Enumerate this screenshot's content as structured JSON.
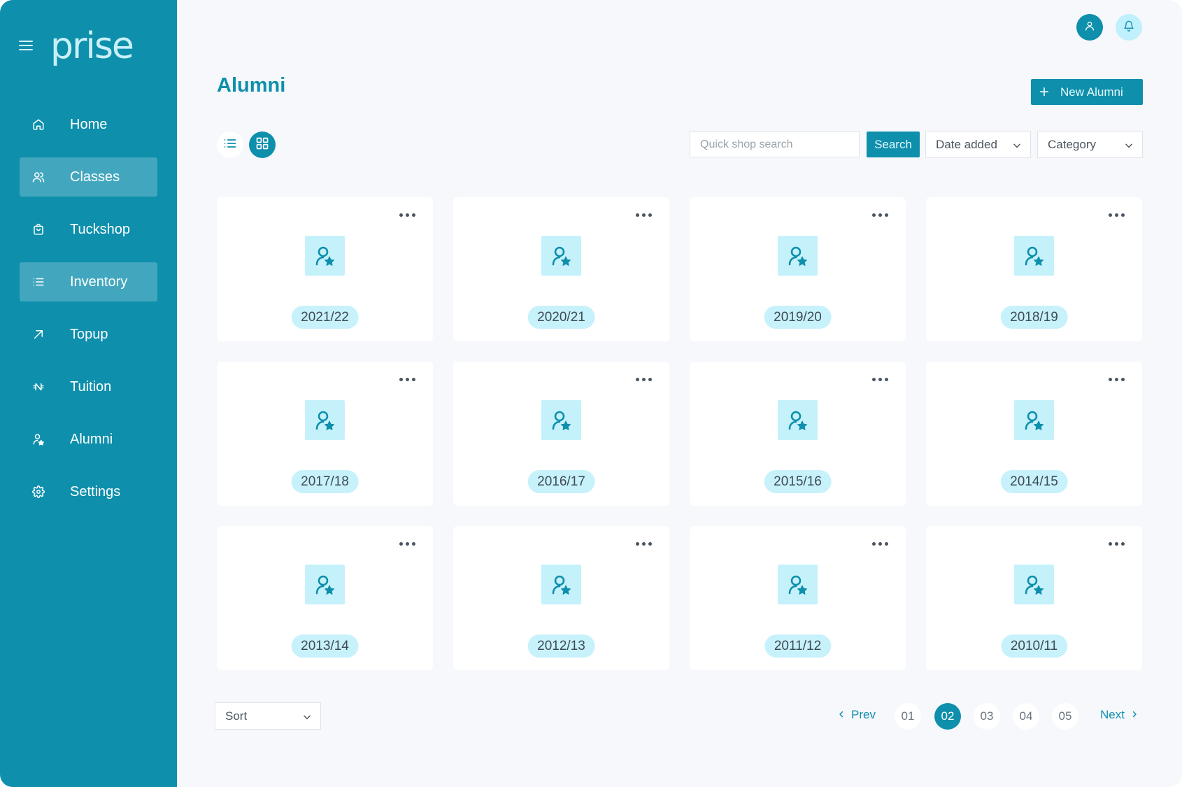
{
  "app": {
    "logo": "prise"
  },
  "sidebar": {
    "items": [
      {
        "label": "Home",
        "icon": "home-icon",
        "active": false
      },
      {
        "label": "Classes",
        "icon": "users-icon",
        "active": true
      },
      {
        "label": "Tuckshop",
        "icon": "shopping-bag-icon",
        "active": false
      },
      {
        "label": "Inventory",
        "icon": "list-icon",
        "active": true
      },
      {
        "label": "Topup",
        "icon": "arrow-up-right-icon",
        "active": false
      },
      {
        "label": "Tuition",
        "icon": "naira-icon",
        "active": false
      },
      {
        "label": "Alumni",
        "icon": "user-star-icon",
        "active": false
      },
      {
        "label": "Settings",
        "icon": "gear-icon",
        "active": false
      }
    ]
  },
  "header": {
    "title": "Alumni",
    "new_button_label": "New Alumni"
  },
  "toolbar": {
    "search_placeholder": "Quick shop search",
    "search_button": "Search",
    "date_select": "Date added",
    "category_select": "Category"
  },
  "cards": [
    {
      "label": "2021/22"
    },
    {
      "label": "2020/21"
    },
    {
      "label": "2019/20"
    },
    {
      "label": "2018/19"
    },
    {
      "label": "2017/18"
    },
    {
      "label": "2016/17"
    },
    {
      "label": "2015/16"
    },
    {
      "label": "2014/15"
    },
    {
      "label": "2013/14"
    },
    {
      "label": "2012/13"
    },
    {
      "label": "2011/12"
    },
    {
      "label": "2010/11"
    }
  ],
  "footer": {
    "sort_label": "Sort",
    "prev_label": "Prev",
    "next_label": "Next",
    "pages": [
      "01",
      "02",
      "03",
      "04",
      "05"
    ],
    "current_page": "02"
  },
  "colors": {
    "brand": "#0e8fac",
    "accent_light": "#c8f2fb",
    "background": "#f6f8fb"
  }
}
